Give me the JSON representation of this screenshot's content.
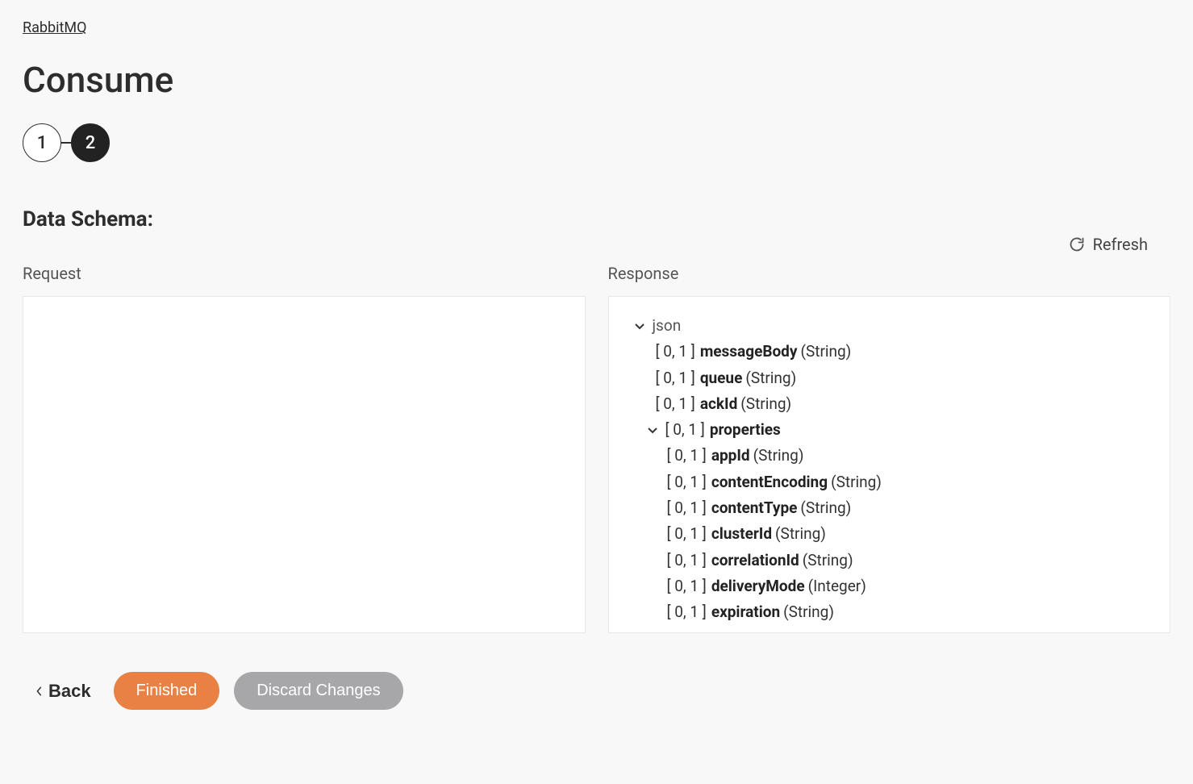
{
  "breadcrumb": "RabbitMQ",
  "title": "Consume",
  "steps": {
    "step1": "1",
    "step2": "2"
  },
  "section_title": "Data Schema:",
  "refresh_label": "Refresh",
  "request_label": "Request",
  "response_label": "Response",
  "response_tree": {
    "root": "json",
    "fields": [
      {
        "cardinality": "[ 0, 1 ]",
        "name": "messageBody",
        "type": "(String)"
      },
      {
        "cardinality": "[ 0, 1 ]",
        "name": "queue",
        "type": "(String)"
      },
      {
        "cardinality": "[ 0, 1 ]",
        "name": "ackId",
        "type": "(String)"
      }
    ],
    "properties_node": {
      "cardinality": "[ 0, 1 ]",
      "name": "properties"
    },
    "properties_children": [
      {
        "cardinality": "[ 0, 1 ]",
        "name": "appId",
        "type": "(String)"
      },
      {
        "cardinality": "[ 0, 1 ]",
        "name": "contentEncoding",
        "type": "(String)"
      },
      {
        "cardinality": "[ 0, 1 ]",
        "name": "contentType",
        "type": "(String)"
      },
      {
        "cardinality": "[ 0, 1 ]",
        "name": "clusterId",
        "type": "(String)"
      },
      {
        "cardinality": "[ 0, 1 ]",
        "name": "correlationId",
        "type": "(String)"
      },
      {
        "cardinality": "[ 0, 1 ]",
        "name": "deliveryMode",
        "type": "(Integer)"
      },
      {
        "cardinality": "[ 0, 1 ]",
        "name": "expiration",
        "type": "(String)"
      }
    ]
  },
  "actions": {
    "back": "Back",
    "finished": "Finished",
    "discard": "Discard Changes"
  }
}
